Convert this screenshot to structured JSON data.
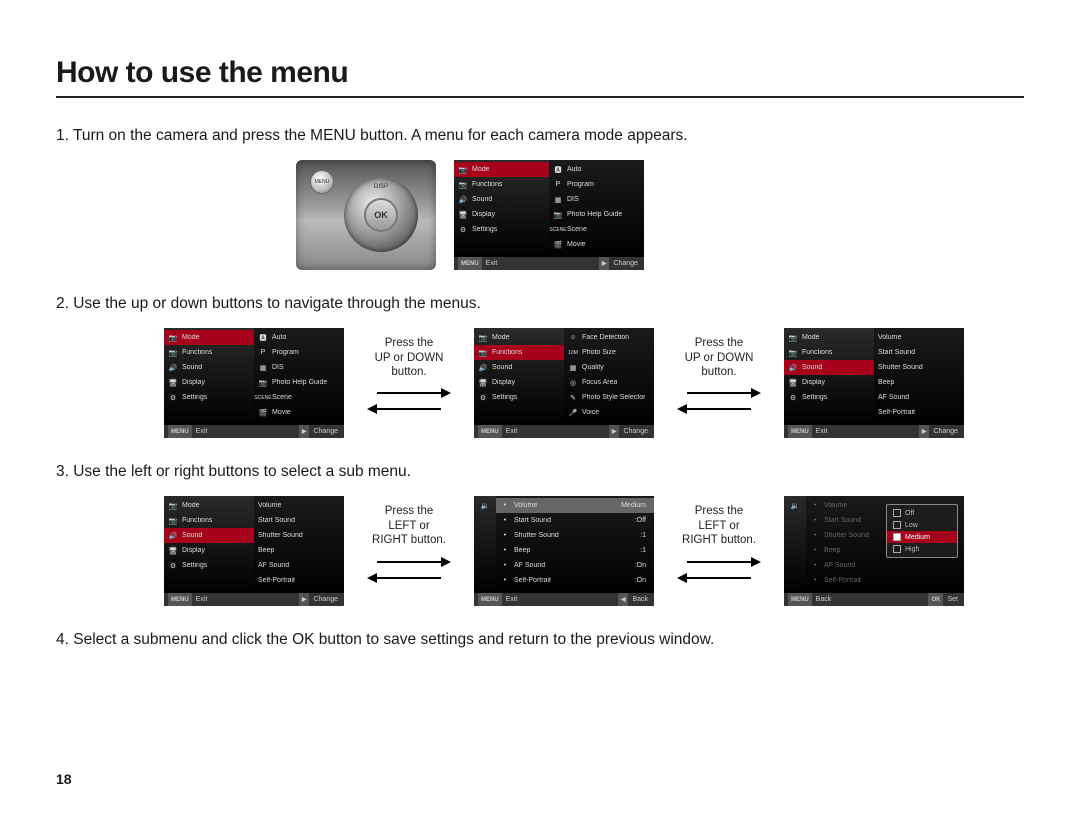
{
  "title": "How to use the menu",
  "page_number": "18",
  "steps": {
    "s1": "1. Turn on the camera and press the MENU button. A menu for each camera mode appears.",
    "s2": "2. Use the up or down buttons to navigate through the menus.",
    "s3": "3. Use the left or right buttons to select a sub menu.",
    "s4": "4. Select a submenu and click the OK button to save settings and return to the previous window."
  },
  "camera": {
    "ok": "OK",
    "disp": "DISP",
    "menu": "MENU"
  },
  "captions": {
    "updown": "Press the\nUP or DOWN\nbutton.",
    "leftright": "Press the\nLEFT or\nRIGHT button."
  },
  "lcd_main_menu": {
    "left": [
      "Mode",
      "Functions",
      "Sound",
      "Display",
      "Settings"
    ],
    "right": [
      "Auto",
      "Program",
      "DIS",
      "Photo Help Guide",
      "Scene",
      "Movie"
    ],
    "foot_left_btn": "MENU",
    "foot_left": "Exit",
    "foot_right_btn": "▶",
    "foot_right": "Change",
    "foot_back_btn": "◀",
    "foot_back": "Back",
    "foot_set_btn": "OK",
    "foot_set": "Set",
    "scene_prefix": "SCENE"
  },
  "lcd_functions_right": [
    "Face Detection",
    "Photo Size",
    "Quality",
    "Focus Area",
    "Photo Style Selector",
    "Voice"
  ],
  "lcd_sound_right": [
    "Volume",
    "Start Sound",
    "Shutter Sound",
    "Beep",
    "AF Sound",
    "Self-Portrait"
  ],
  "lcd_sound_values": {
    "Volume": "Medium",
    "Start Sound": ":Off",
    "Shutter Sound": ":1",
    "Beep": ":1",
    "AF Sound": ":On",
    "Self-Portrait": ":On"
  },
  "popup_volume": [
    "Off",
    "Low",
    "Medium",
    "High"
  ],
  "icons": {
    "mode": "📷",
    "functions": "📷",
    "sound": "🔊",
    "display": "🖥",
    "settings": "⚙",
    "auto": "🅰",
    "program": "P",
    "dis": "▦",
    "guide": "📷",
    "scene": "",
    "movie": "🎬",
    "face": "☺",
    "size": "10M",
    "quality": "▦",
    "focus": "◎",
    "style": "✎",
    "voice": "🎤",
    "dot": "•",
    "speaker": "🔉"
  }
}
